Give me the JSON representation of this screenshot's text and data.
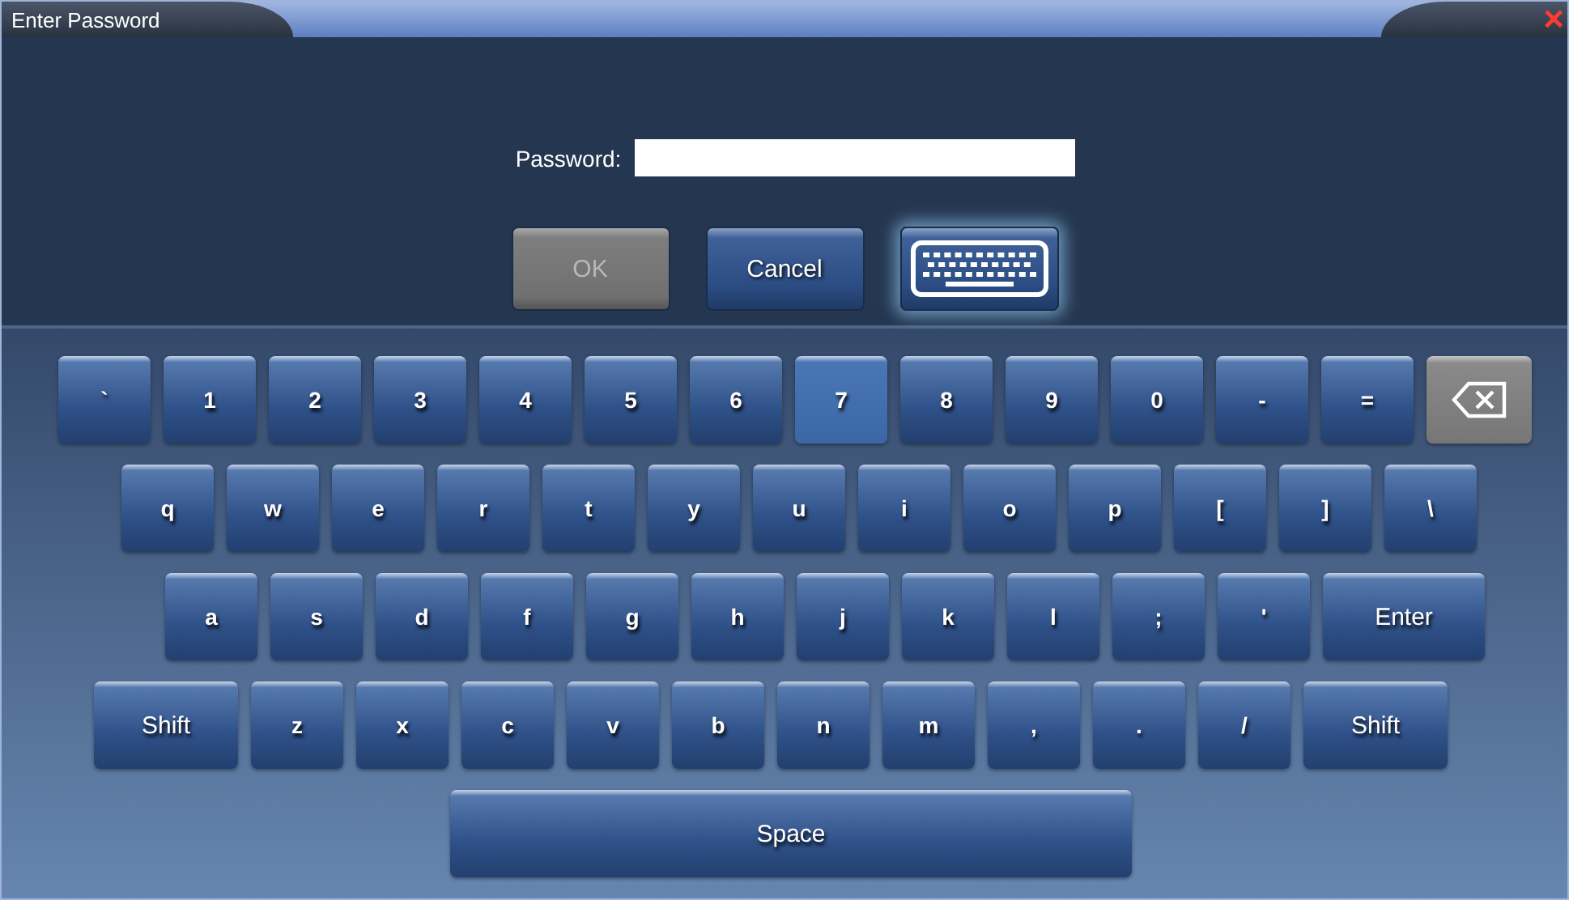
{
  "window": {
    "title": "Enter Password",
    "close": "×"
  },
  "password": {
    "label": "Password:"
  },
  "buttons": [
    {
      "kind": "text",
      "label": "OK",
      "disabled": true
    },
    {
      "kind": "text",
      "label": "Cancel",
      "disabled": false
    },
    {
      "kind": "keyboard",
      "selected": true
    }
  ],
  "keyboard": {
    "rows": [
      [
        {
          "kind": "key",
          "label": "`",
          "selected": false
        },
        {
          "kind": "key",
          "label": "1",
          "selected": false
        },
        {
          "kind": "key",
          "label": "2",
          "selected": false
        },
        {
          "kind": "key",
          "label": "3",
          "selected": false
        },
        {
          "kind": "key",
          "label": "4",
          "selected": false
        },
        {
          "kind": "key",
          "label": "5",
          "selected": false
        },
        {
          "kind": "key",
          "label": "6",
          "selected": false
        },
        {
          "kind": "key",
          "label": "7",
          "selected": true
        },
        {
          "kind": "key",
          "label": "8",
          "selected": false
        },
        {
          "kind": "key",
          "label": "9",
          "selected": false
        },
        {
          "kind": "key",
          "label": "0",
          "selected": false
        },
        {
          "kind": "key",
          "label": "-",
          "selected": false
        },
        {
          "kind": "key",
          "label": "=",
          "selected": false
        },
        {
          "kind": "backspace",
          "selected": false
        }
      ],
      [
        {
          "kind": "key",
          "label": "q",
          "selected": false
        },
        {
          "kind": "key",
          "label": "w",
          "selected": false
        },
        {
          "kind": "key",
          "label": "e",
          "selected": false
        },
        {
          "kind": "key",
          "label": "r",
          "selected": false
        },
        {
          "kind": "key",
          "label": "t",
          "selected": false
        },
        {
          "kind": "key",
          "label": "y",
          "selected": false
        },
        {
          "kind": "key",
          "label": "u",
          "selected": false
        },
        {
          "kind": "key",
          "label": "i",
          "selected": false
        },
        {
          "kind": "key",
          "label": "o",
          "selected": false
        },
        {
          "kind": "key",
          "label": "p",
          "selected": false
        },
        {
          "kind": "key",
          "label": "[",
          "selected": false
        },
        {
          "kind": "key",
          "label": "]",
          "selected": false
        },
        {
          "kind": "key",
          "label": "\\",
          "selected": false
        }
      ],
      [
        {
          "kind": "key",
          "label": "a",
          "selected": false
        },
        {
          "kind": "key",
          "label": "s",
          "selected": false
        },
        {
          "kind": "key",
          "label": "d",
          "selected": false
        },
        {
          "kind": "key",
          "label": "f",
          "selected": false
        },
        {
          "kind": "key",
          "label": "g",
          "selected": false
        },
        {
          "kind": "key",
          "label": "h",
          "selected": false
        },
        {
          "kind": "key",
          "label": "j",
          "selected": false
        },
        {
          "kind": "key",
          "label": "k",
          "selected": false
        },
        {
          "kind": "key",
          "label": "l",
          "selected": false
        },
        {
          "kind": "key",
          "label": ";",
          "selected": false
        },
        {
          "kind": "key",
          "label": "'",
          "selected": false
        },
        {
          "kind": "enter",
          "label": "Enter",
          "selected": false
        }
      ],
      [
        {
          "kind": "shift",
          "label": "Shift",
          "selected": false
        },
        {
          "kind": "key",
          "label": "z",
          "selected": false
        },
        {
          "kind": "key",
          "label": "x",
          "selected": false
        },
        {
          "kind": "key",
          "label": "c",
          "selected": false
        },
        {
          "kind": "key",
          "label": "v",
          "selected": false
        },
        {
          "kind": "key",
          "label": "b",
          "selected": false
        },
        {
          "kind": "key",
          "label": "n",
          "selected": false
        },
        {
          "kind": "key",
          "label": "m",
          "selected": false
        },
        {
          "kind": "key",
          "label": ",",
          "selected": false
        },
        {
          "kind": "key",
          "label": ".",
          "selected": false
        },
        {
          "kind": "key",
          "label": "/",
          "selected": false
        },
        {
          "kind": "shift",
          "label": "Shift",
          "selected": false
        }
      ],
      [
        {
          "kind": "space",
          "label": "Space",
          "selected": false
        }
      ]
    ]
  }
}
